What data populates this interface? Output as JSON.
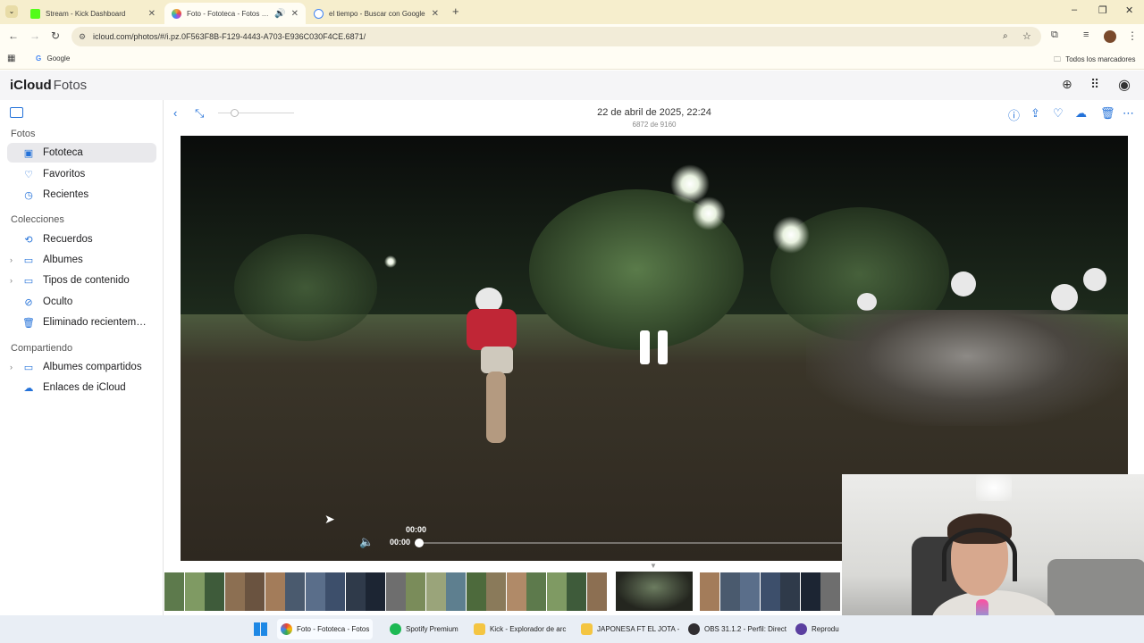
{
  "browser": {
    "tabs": [
      {
        "title": "Stream - Kick Dashboard",
        "favicon": "kick-icon",
        "color": "#53fc18",
        "active": false
      },
      {
        "title": "Foto - Fototeca - Fotos en i...",
        "favicon": "icloud-photos-icon",
        "color": "#f2a33a",
        "active": true
      },
      {
        "title": "el tiempo - Buscar con Google",
        "favicon": "google-icon",
        "color": "#4285f4",
        "active": false
      }
    ],
    "url": "icloud.com/photos/#/i.pz.0F563F8B-F129-4443-A703-E936C030F4CE.6871/",
    "bookmarks": [
      {
        "label": "Google"
      }
    ],
    "bookmarks_right": "Todos los marcadores"
  },
  "app": {
    "brand_name": "iCloud",
    "section_name": "Fotos"
  },
  "sidebar": {
    "groups": [
      {
        "title": "Fotos",
        "items": [
          {
            "label": "Fototeca",
            "icon": "photo-library-icon",
            "selected": true,
            "expandable": false
          },
          {
            "label": "Favoritos",
            "icon": "heart-icon",
            "selected": false,
            "expandable": false
          },
          {
            "label": "Recientes",
            "icon": "clock-icon",
            "selected": false,
            "expandable": false
          }
        ]
      },
      {
        "title": "Colecciones",
        "items": [
          {
            "label": "Recuerdos",
            "icon": "memories-icon",
            "selected": false,
            "expandable": false
          },
          {
            "label": "Álbumes",
            "icon": "album-icon",
            "selected": false,
            "expandable": true
          },
          {
            "label": "Tipos de contenido",
            "icon": "media-types-icon",
            "selected": false,
            "expandable": true
          },
          {
            "label": "Oculto",
            "icon": "eye-slash-icon",
            "selected": false,
            "expandable": false
          },
          {
            "label": "Eliminado recienteme...",
            "icon": "trash-icon",
            "selected": false,
            "expandable": false
          }
        ]
      },
      {
        "title": "Compartiendo",
        "items": [
          {
            "label": "Álbumes compartidos",
            "icon": "shared-album-icon",
            "selected": false,
            "expandable": true
          },
          {
            "label": "Enlaces de iCloud",
            "icon": "icloud-link-icon",
            "selected": false,
            "expandable": false
          }
        ]
      }
    ]
  },
  "viewer": {
    "date_title": "22 de abril de 2025, 22:24",
    "count_text": "6872 de 9160",
    "video": {
      "state": "playing",
      "time_tooltip": "00:00",
      "current_time": "00:00",
      "progress": 0.0
    }
  },
  "taskbar": {
    "items": [
      {
        "label": "Foto - Fototeca - Fotos",
        "icon": "chrome-icon",
        "color": "#4285f4",
        "active": true
      },
      {
        "label": "Spotify Premium",
        "icon": "spotify-icon",
        "color": "#1db954",
        "active": false
      },
      {
        "label": "Kick - Explorador de arc",
        "icon": "folder-icon",
        "color": "#f4c542",
        "active": false
      },
      {
        "label": "JAPONESA FT EL JOTA -",
        "icon": "folder-icon",
        "color": "#f4c542",
        "active": false
      },
      {
        "label": "OBS 31.1.2 - Perfil: Direct",
        "icon": "obs-icon",
        "color": "#302e31",
        "active": false
      },
      {
        "label": "Reprodu",
        "icon": "media-player-icon",
        "color": "#5b3fa0",
        "active": false
      }
    ]
  },
  "colors": {
    "accent": "#2472d9",
    "sidebar_selected": "#e9e9ec",
    "browser_frame": "#f6eecd"
  }
}
